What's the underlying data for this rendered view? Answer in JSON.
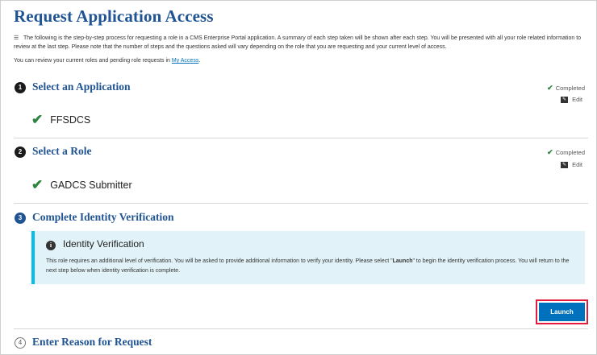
{
  "page": {
    "title": "Request Application Access",
    "intro": "The following is the step-by-step process for requesting a role in a CMS Enterprise Portal application. A summary of each step taken will be shown after each step. You will be presented with all your role related information to review at the last step. Please note that the number of steps and the questions asked will vary depending on the role that you are requesting and your current level of access.",
    "review_prefix": "You can review your current roles and pending role requests in",
    "review_link": "My Access",
    "review_suffix": "."
  },
  "steps": [
    {
      "number": "1",
      "title": "Select an Application",
      "status": "Completed",
      "edit_label": "Edit",
      "selection": "FFSDCS"
    },
    {
      "number": "2",
      "title": "Select a Role",
      "status": "Completed",
      "edit_label": "Edit",
      "selection": "GADCS Submitter"
    },
    {
      "number": "3",
      "title": "Complete Identity Verification"
    },
    {
      "number": "4",
      "title": "Enter Reason for Request"
    }
  ],
  "alert": {
    "heading": "Identity Verification",
    "body_part1": "This role requires an additional level of verification. You will be asked to provide additional information to verify your identity. Please select \"",
    "body_bold": "Launch",
    "body_part2": "\" to begin the identity verification process. You will return to the next step below when identity verification is complete."
  },
  "launch_button": "Launch",
  "colors": {
    "heading_blue": "#205493",
    "button_blue": "#0071bc",
    "success_green": "#2e8540",
    "alert_bg": "#e1f3f8",
    "alert_border": "#02bfe7",
    "highlight_red": "#e31c3d"
  }
}
